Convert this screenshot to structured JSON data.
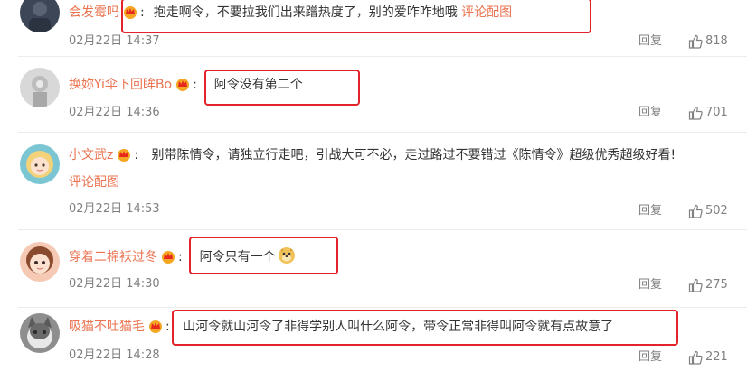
{
  "comments": [
    {
      "username": "会发霉吗",
      "text": "抱走啊令，不要拉我们出来蹭热度了，别的爱咋咋地哦",
      "link": "评论配图",
      "time": "02月22日 14:37",
      "reply": "回复",
      "likes": "818",
      "avatar_color": "#3d4656"
    },
    {
      "username": "换妳Yi伞下回眸Bo",
      "text": "阿令没有第二个",
      "time": "02月22日 14:36",
      "reply": "回复",
      "likes": "701",
      "avatar_color": "#c8c8c8"
    },
    {
      "username": "小文武z",
      "text": "别带陈情令，请独立行走吧，引战大可不必，走过路过不要错过《陈情令》超级优秀超级好看!",
      "link": "评论配图",
      "time": "02月22日 14:53",
      "reply": "回复",
      "likes": "502",
      "avatar_color": "#6fbfcf"
    },
    {
      "username": "穿着二棉袄过冬",
      "text": "阿令只有一个",
      "emoji": "doge-emoji",
      "time": "02月22日 14:30",
      "reply": "回复",
      "likes": "275",
      "avatar_color": "#f2b9a3"
    },
    {
      "username": "吸猫不吐猫毛",
      "text": "山河令就山河令了非得学别人叫什么阿令，带令正常非得叫阿令就有点故意了",
      "time": "02月22日 14:28",
      "reply": "回复",
      "likes": "221",
      "avatar_color": "#9a9a9a"
    }
  ],
  "colors": {
    "username": "#eb7350",
    "highlight_box": "#e2232a",
    "meta_text": "#808080"
  }
}
